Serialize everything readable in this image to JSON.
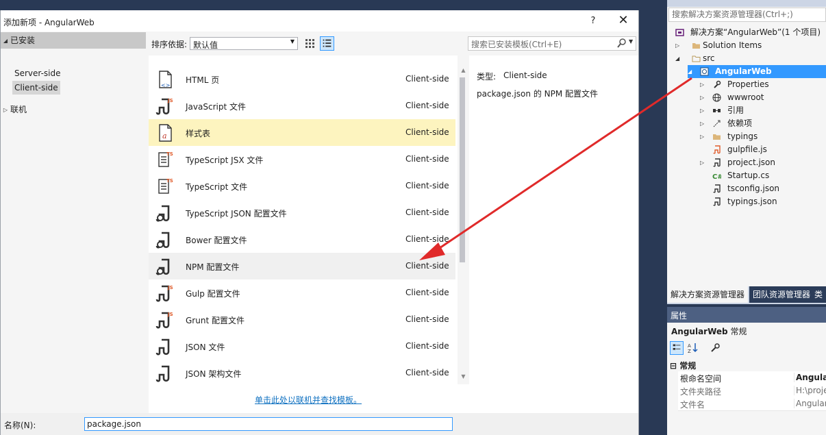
{
  "dialog": {
    "title": "添加新项 - AngularWeb",
    "help_label": "?",
    "close_label": "✕"
  },
  "left_tree": {
    "installed": "已安装",
    "server_side": "Server-side",
    "client_side": "Client-side",
    "online": "联机"
  },
  "toolbar": {
    "sort_label": "排序依据:",
    "sort_value": "默认值"
  },
  "templates": [
    {
      "name": "HTML 页",
      "category": "Client-side",
      "icon": "html-file-icon"
    },
    {
      "name": "JavaScript 文件",
      "category": "Client-side",
      "icon": "javascript-file-icon"
    },
    {
      "name": "样式表",
      "category": "Client-side",
      "icon": "stylesheet-file-icon"
    },
    {
      "name": "TypeScript JSX 文件",
      "category": "Client-side",
      "icon": "typescript-jsx-file-icon"
    },
    {
      "name": "TypeScript 文件",
      "category": "Client-side",
      "icon": "typescript-file-icon"
    },
    {
      "name": "TypeScript JSON 配置文件",
      "category": "Client-side",
      "icon": "json-config-file-icon"
    },
    {
      "name": "Bower 配置文件",
      "category": "Client-side",
      "icon": "json-config-file-icon"
    },
    {
      "name": "NPM 配置文件",
      "category": "Client-side",
      "icon": "json-config-file-icon"
    },
    {
      "name": "Gulp 配置文件",
      "category": "Client-side",
      "icon": "javascript-file-icon"
    },
    {
      "name": "Grunt 配置文件",
      "category": "Client-side",
      "icon": "javascript-file-icon"
    },
    {
      "name": "JSON 文件",
      "category": "Client-side",
      "icon": "json-file-icon"
    },
    {
      "name": "JSON 架构文件",
      "category": "Client-side",
      "icon": "json-file-icon"
    }
  ],
  "online_link": "单击此处以联机并查找模板。",
  "search": {
    "placeholder": "搜索已安装模板(Ctrl+E)"
  },
  "details": {
    "type_label": "类型:",
    "type_value": "Client-side",
    "description": "package.json 的 NPM 配置文件"
  },
  "bottom": {
    "name_label": "名称(N):",
    "name_value": "package.json"
  },
  "solution_explorer": {
    "search_placeholder": "搜索解决方案资源管理器(Ctrl+;)",
    "rows": [
      {
        "label": "解决方案“AngularWeb”(1 个项目)",
        "icon": "solution-icon"
      },
      {
        "label": "Solution Items",
        "icon": "folder-icon"
      },
      {
        "label": "src",
        "icon": "folder-icon"
      },
      {
        "label": "AngularWeb",
        "icon": "web-project-icon"
      },
      {
        "label": "Properties",
        "icon": "wrench-icon"
      },
      {
        "label": "wwwroot",
        "icon": "globe-icon"
      },
      {
        "label": "引用",
        "icon": "references-icon"
      },
      {
        "label": "依赖项",
        "icon": "dependencies-icon"
      },
      {
        "label": "typings",
        "icon": "folder-icon"
      },
      {
        "label": "gulpfile.js",
        "icon": "javascript-file-icon"
      },
      {
        "label": "project.json",
        "icon": "json-file-icon"
      },
      {
        "label": "Startup.cs",
        "icon": "csharp-file-icon"
      },
      {
        "label": "tsconfig.json",
        "icon": "json-file-icon"
      },
      {
        "label": "typings.json",
        "icon": "json-file-icon"
      }
    ],
    "tabs": [
      "解决方案资源管理器",
      "团队资源管理器",
      "类"
    ]
  },
  "properties": {
    "header": "属性",
    "object_name": "AngularWeb",
    "object_type": "常规",
    "category": "常规",
    "rows": [
      {
        "key": "根命名空间",
        "value": "Angular"
      },
      {
        "key": "文件夹路径",
        "value": "H:\\proje"
      },
      {
        "key": "文件名",
        "value": "Angular"
      }
    ]
  },
  "colors": {
    "accent": "#3399ff",
    "selected_item": "#fdf4bf",
    "arrow": "#e02a2a",
    "link": "#0e70c0"
  }
}
